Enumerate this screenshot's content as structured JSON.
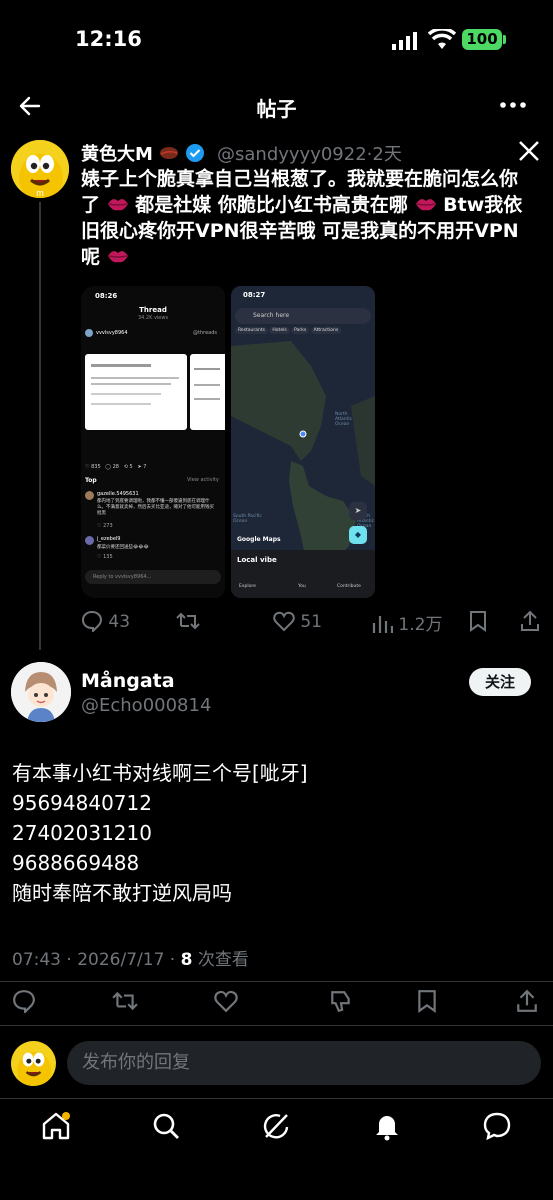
{
  "status": {
    "time": "12:16",
    "battery": "100"
  },
  "nav": {
    "title": "帖子"
  },
  "post": {
    "name": "黄色大M",
    "handle": "@sandyyyy0922",
    "age": "2天",
    "text_parts": [
      {
        "t": "婊子上个脆真拿自己当根葱了。我就要在脆问怎么你了",
        "lips": true
      },
      {
        "t": " 都是社媒 你脆比小红书高贵在哪 ",
        "lips": true
      },
      {
        "t": "Btw我依旧很心疼你开VPN很辛苦哦 可是我真的不用开VPN呢",
        "lips": true
      }
    ],
    "shot1": {
      "time": "08:26",
      "header": "Thread",
      "sub": "34.2K views",
      "user": "vvvlsvy8964",
      "brand": "@threads",
      "counts": {
        "likes": "835",
        "replies": "28",
        "reposts": "5",
        "shares": "7"
      },
      "top": "Top",
      "view_activity": "View activity",
      "c1_user": "gazelle.5495631",
      "c1_text": "都内地了到底要调理啦，我都不懂一部傻逼到底在调理什么。不满意就卖掉，然后去买比亚迪，赌对了他可能用钱买批黑",
      "c1_likes": "273",
      "c2_user": "j_ezebel9",
      "c2_text": "都菜价要还回送些😂😂😂",
      "c2_likes": "135",
      "reply_placeholder": "Reply to vvvlsvy8964..."
    },
    "shot2": {
      "time": "08:27",
      "search": "Search here",
      "chips": [
        "Restaurants",
        "Hotels",
        "Parks",
        "Attractions"
      ],
      "ocean1": "North Atlantic Ocean",
      "ocean2": "South Pacific Ocean",
      "ocean3": "South Atlantic Ocean",
      "brand": "Google Maps",
      "sheet": "Local vibe",
      "tabs": [
        "Explore",
        "You",
        "Contribute"
      ]
    },
    "actions": {
      "replies": "43",
      "likes": "51",
      "views": "1.2万"
    }
  },
  "reply": {
    "name": "Mångata",
    "handle": "@Echo000814",
    "follow": "关注",
    "text": "有本事小红书对线啊三个号[呲牙]\n95694840712\n27402031210\n9688669488\n随时奉陪不敢打逆风局吗",
    "time": "07:43",
    "date": "2026/7/17",
    "views_count": "8",
    "views_label": "次查看"
  },
  "compose": {
    "placeholder": "发布你的回复"
  },
  "colors": {
    "accent": "#1d9bf0",
    "lips": "#c2185b",
    "muted": "#71767b",
    "battery": "#4cd964"
  }
}
